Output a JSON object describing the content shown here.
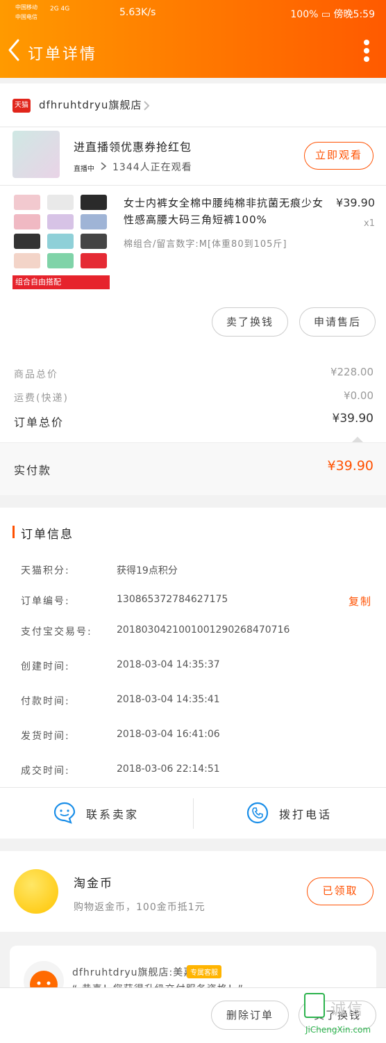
{
  "status_bar": {
    "carrier1": "中国移动",
    "carrier2": "中国电信",
    "signal": "2G 4G",
    "speed": "5.63K/s",
    "battery": "100%",
    "time": "傍晚5:59"
  },
  "nav": {
    "title": "订单详情"
  },
  "shop": {
    "name": "dfhruhtdryu旗舰店",
    "logo_text": "天猫"
  },
  "live": {
    "title": "进直播领优惠券抢红包",
    "badge": "直播中",
    "viewers": "1344人正在观看",
    "button": "立即观看"
  },
  "product": {
    "title": "女士内裤女全棉中腰纯棉非抗菌无痕少女性感高腰大码三角短裤100%",
    "sku": "棉组合/留言数字:M[体重80到105斤]",
    "price": "¥39.90",
    "quantity": "x1",
    "promo": "组合自由搭配",
    "actions": [
      "卖了换钱",
      "申请售后"
    ]
  },
  "summary": {
    "goods_label": "商品总价",
    "goods_value": "¥228.00",
    "shipping_label": "运费(快递)",
    "shipping_value": "¥0.00",
    "total_label": "订单总价",
    "total_value": "¥39.90",
    "paid_label": "实付款",
    "paid_value": "¥39.90"
  },
  "order_info": {
    "title": "订单信息",
    "rows": [
      {
        "label": "天猫积分:",
        "value": "获得19点积分"
      },
      {
        "label": "订单编号:",
        "value": "130865372784627175"
      },
      {
        "label": "支付宝交易号:",
        "value": "2018030421001001290268470716"
      },
      {
        "label": "创建时间:",
        "value": "2018-03-04 14:35:37"
      },
      {
        "label": "付款时间:",
        "value": "2018-03-04 14:35:41"
      },
      {
        "label": "发货时间:",
        "value": "2018-03-04 16:41:06"
      },
      {
        "label": "成交时间:",
        "value": "2018-03-06 22:14:51"
      }
    ],
    "copy": "复制",
    "contact_seller": "联系卖家",
    "call_phone": "拨打电话"
  },
  "coins": {
    "title": "淘金币",
    "subtitle": "购物返金币，100金币抵1元",
    "button": "已领取"
  },
  "service": {
    "name": "dfhruhtdryu旗舰店:美嘉",
    "badge": "专属客服",
    "message": "“ 恭喜！您获得升级交付服务资格！”"
  },
  "bottom": {
    "delete": "删除订单",
    "sell": "卖了换钱"
  },
  "watermark": {
    "text": "诚信",
    "url": "JiChengXin.com"
  },
  "colors": {
    "accent": "#ff5000",
    "header_start": "#ff9a00",
    "header_end": "#ff5a00"
  }
}
